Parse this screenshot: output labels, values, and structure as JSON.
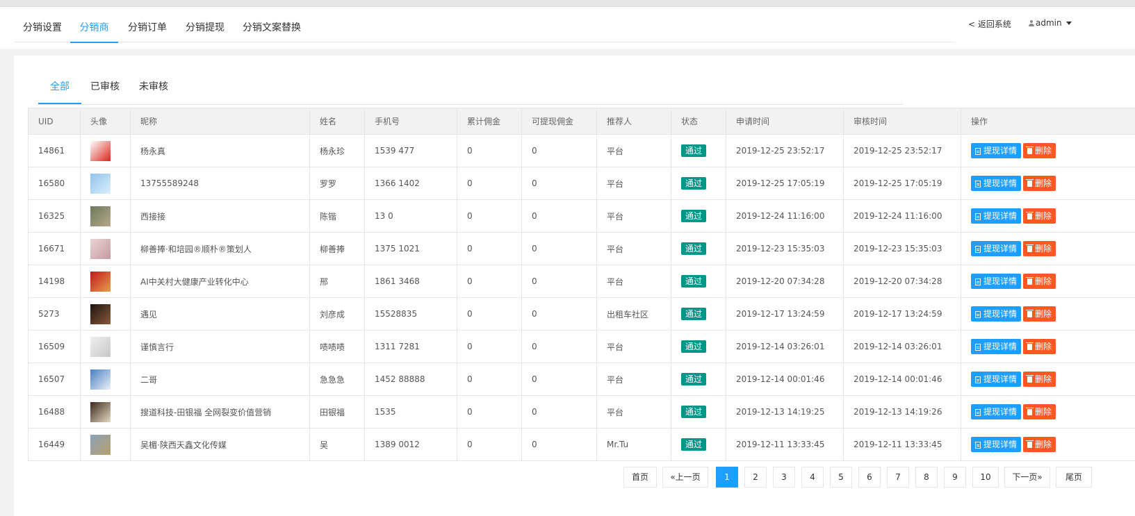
{
  "nav": {
    "tabs": [
      {
        "label": "分销设置",
        "active": false
      },
      {
        "label": "分销商",
        "active": true
      },
      {
        "label": "分销订单",
        "active": false
      },
      {
        "label": "分销提现",
        "active": false
      },
      {
        "label": "分销文案替换",
        "active": false
      }
    ],
    "back_label": "< 返回系统",
    "user_label": "admin"
  },
  "subtabs": [
    {
      "label": "全部",
      "active": true
    },
    {
      "label": "已审核",
      "active": false
    },
    {
      "label": "未审核",
      "active": false
    }
  ],
  "table": {
    "headers": [
      "UID",
      "头像",
      "昵称",
      "姓名",
      "手机号",
      "累计佣金",
      "可提现佣金",
      "推荐人",
      "状态",
      "申请时间",
      "审核时间",
      "操作"
    ],
    "rows": [
      {
        "uid": "14861",
        "nickname": "杨永真",
        "name": "杨永珍",
        "phone": "1539    477",
        "total": "0",
        "withdrawable": "0",
        "referrer": "平台",
        "status": "通过",
        "apply_time": "2019-12-25 23:52:17",
        "review_time": "2019-12-25 23:52:17",
        "avatar_colors": [
          "#ffffff",
          "#d9261c"
        ]
      },
      {
        "uid": "16580",
        "nickname": "13755589248",
        "name": "罗罗",
        "phone": "1366    1402",
        "total": "0",
        "withdrawable": "0",
        "referrer": "平台",
        "status": "通过",
        "apply_time": "2019-12-25 17:05:19",
        "review_time": "2019-12-25 17:05:19",
        "avatar_colors": [
          "#8fc4ea",
          "#dbeefb"
        ]
      },
      {
        "uid": "16325",
        "nickname": "西接接",
        "name": "陈锴",
        "phone": "13        0",
        "total": "0",
        "withdrawable": "0",
        "referrer": "平台",
        "status": "通过",
        "apply_time": "2019-12-24 11:16:00",
        "review_time": "2019-12-24 11:16:00",
        "avatar_colors": [
          "#6b7a5c",
          "#b9a88a"
        ]
      },
      {
        "uid": "16671",
        "nickname": "柳善捧·和培园®顺朴®策划人",
        "name": "柳善捧",
        "phone": "1375    1021",
        "total": "0",
        "withdrawable": "0",
        "referrer": "平台",
        "status": "通过",
        "apply_time": "2019-12-23 15:35:03",
        "review_time": "2019-12-23 15:35:03",
        "avatar_colors": [
          "#e9d4d6",
          "#c59aa0"
        ]
      },
      {
        "uid": "14198",
        "nickname": "AI中关村大健康产业转化中心",
        "name": "邢",
        "phone": "1861    3468",
        "total": "0",
        "withdrawable": "0",
        "referrer": "平台",
        "status": "通过",
        "apply_time": "2019-12-20 07:34:28",
        "review_time": "2019-12-20 07:34:28",
        "avatar_colors": [
          "#c4161c",
          "#e5a04a"
        ]
      },
      {
        "uid": "5273",
        "nickname": "遇见",
        "name": "刘彦成",
        "phone": "15528835   ",
        "total": "0",
        "withdrawable": "0",
        "referrer": "出租车社区",
        "status": "通过",
        "apply_time": "2019-12-17 13:24:59",
        "review_time": "2019-12-17 13:24:59",
        "avatar_colors": [
          "#1d1410",
          "#8a5a3a"
        ]
      },
      {
        "uid": "16509",
        "nickname": "谨慎言行",
        "name": "啧啧啧",
        "phone": "1311    7281",
        "total": "0",
        "withdrawable": "0",
        "referrer": "平台",
        "status": "通过",
        "apply_time": "2019-12-14 03:26:01",
        "review_time": "2019-12-14 03:26:01",
        "avatar_colors": [
          "#eeeeee",
          "#c8c8c8"
        ]
      },
      {
        "uid": "16507",
        "nickname": "二哥",
        "name": "急急急",
        "phone": "1452    88888",
        "total": "0",
        "withdrawable": "0",
        "referrer": "平台",
        "status": "通过",
        "apply_time": "2019-12-14 00:01:46",
        "review_time": "2019-12-14 00:01:46",
        "avatar_colors": [
          "#4a7fc0",
          "#e9f0f8"
        ]
      },
      {
        "uid": "16488",
        "nickname": "搜道科技-田银福 全网裂变价值营销",
        "name": "田银福",
        "phone": "1535       ",
        "total": "0",
        "withdrawable": "0",
        "referrer": "平台",
        "status": "通过",
        "apply_time": "2019-12-13 14:19:25",
        "review_time": "2019-12-13 14:19:26",
        "avatar_colors": [
          "#3b2a1d",
          "#e7d9c2"
        ]
      },
      {
        "uid": "16449",
        "nickname": "吴楣·陕西天鑫文化传媒",
        "name": "吴",
        "phone": "1389    0012",
        "total": "0",
        "withdrawable": "0",
        "referrer": "Mr.Tu",
        "status": "通过",
        "apply_time": "2019-12-11 13:33:45",
        "review_time": "2019-12-11 13:33:45",
        "avatar_colors": [
          "#8aa0b8",
          "#b8a06a"
        ]
      }
    ],
    "withdraw_label": "提现详情",
    "delete_label": "删除"
  },
  "pagination": {
    "first": "首页",
    "prev": "«上一页",
    "pages": [
      "1",
      "2",
      "3",
      "4",
      "5",
      "6",
      "7",
      "8",
      "9",
      "10"
    ],
    "current": "1",
    "next": "下一页»",
    "last": "尾页"
  },
  "colors": {
    "accent": "#1E9FFF",
    "success": "#009688",
    "danger": "#FF5722"
  }
}
